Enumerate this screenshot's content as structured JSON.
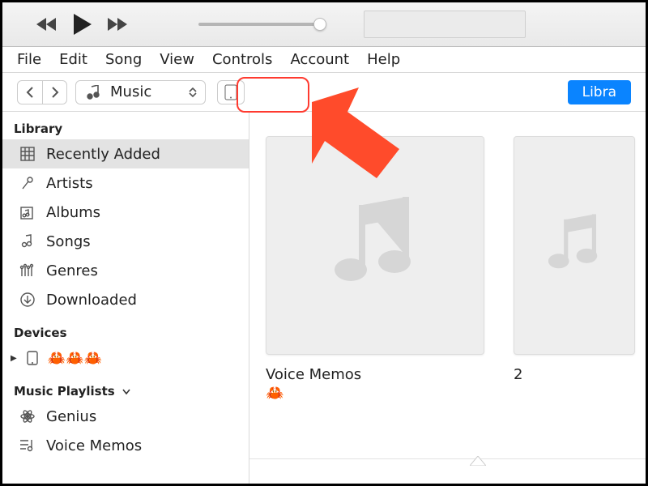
{
  "menubar": [
    "File",
    "Edit",
    "Song",
    "View",
    "Controls",
    "Account",
    "Help"
  ],
  "toolbar": {
    "media_label": "Music",
    "library_btn": "Libra"
  },
  "sidebar": {
    "sections": {
      "library": {
        "title": "Library",
        "items": [
          {
            "id": "recently-added",
            "label": "Recently Added",
            "active": true
          },
          {
            "id": "artists",
            "label": "Artists"
          },
          {
            "id": "albums",
            "label": "Albums"
          },
          {
            "id": "songs",
            "label": "Songs"
          },
          {
            "id": "genres",
            "label": "Genres"
          },
          {
            "id": "downloaded",
            "label": "Downloaded"
          }
        ]
      },
      "devices": {
        "title": "Devices",
        "device_name": "🦀🦀🦀"
      },
      "playlists": {
        "title": "Music Playlists",
        "items": [
          {
            "id": "genius",
            "label": "Genius"
          },
          {
            "id": "voice-memos",
            "label": "Voice Memos"
          }
        ]
      }
    }
  },
  "main": {
    "cards": [
      {
        "title": "Voice Memos",
        "subtitle": "🦀"
      },
      {
        "title": "2",
        "subtitle": ""
      }
    ]
  }
}
